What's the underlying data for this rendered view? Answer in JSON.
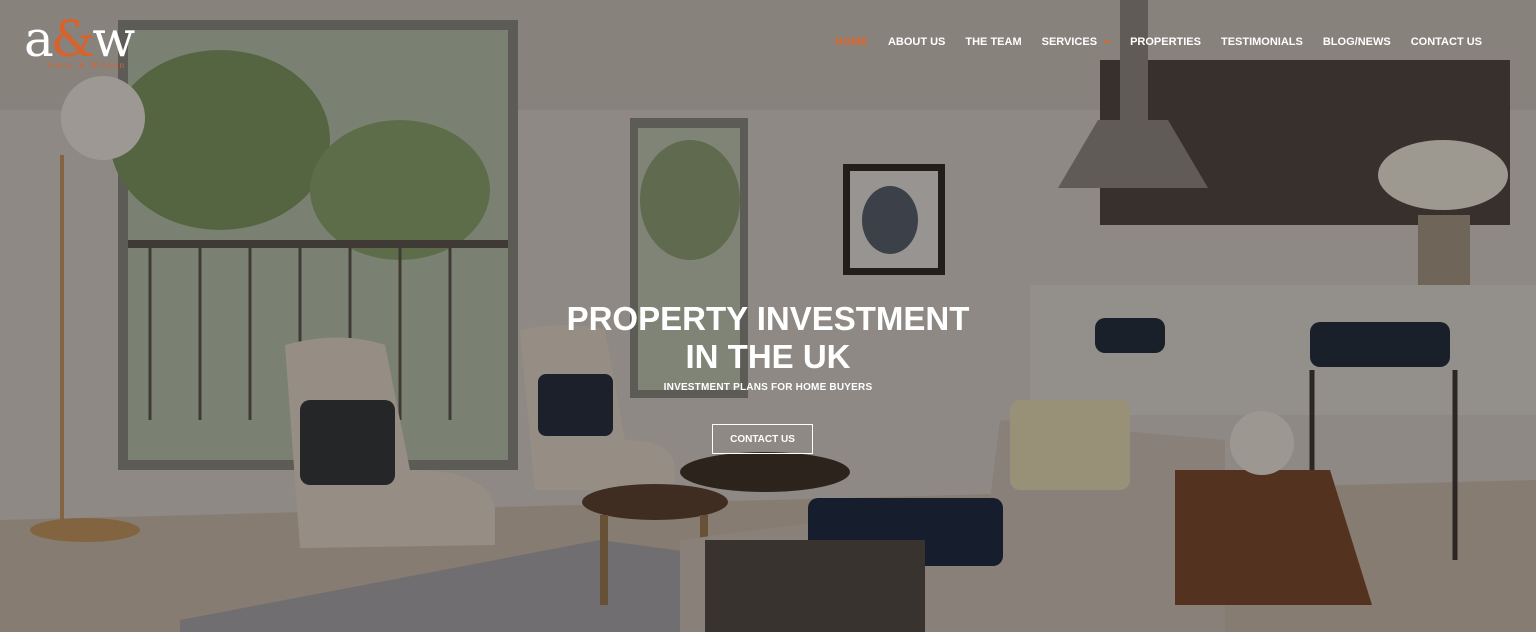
{
  "logo": {
    "mark_a": "a",
    "mark_amp": "&",
    "mark_w": "w",
    "subtitle": "Amin & Wilson"
  },
  "nav": {
    "items": [
      {
        "label": "HOME",
        "active": true
      },
      {
        "label": "ABOUT US"
      },
      {
        "label": "THE TEAM"
      },
      {
        "label": "SERVICES",
        "dropdown": true
      },
      {
        "label": "PROPERTIES"
      },
      {
        "label": "TESTIMONIALS"
      },
      {
        "label": "BLOG/NEWS"
      },
      {
        "label": "CONTACT US"
      }
    ]
  },
  "hero": {
    "title_line1": "PROPERTY INVESTMENT",
    "title_line2": "IN THE UK",
    "subtitle": "INVESTMENT PLANS FOR HOME BUYERS",
    "cta_label": "CONTACT US"
  },
  "colors": {
    "accent": "#e0632b",
    "text": "#ffffff"
  }
}
